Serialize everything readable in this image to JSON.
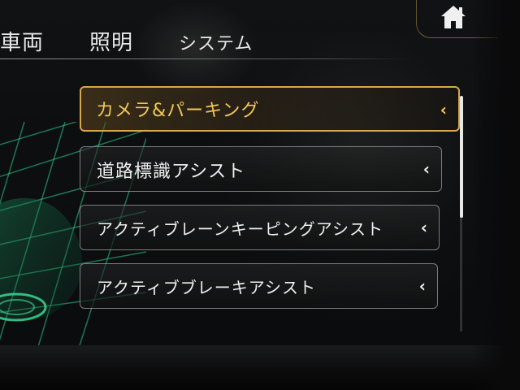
{
  "nav": {
    "tabs": [
      {
        "label": "車両",
        "active": false
      },
      {
        "label": "照明",
        "active": false
      },
      {
        "label": "システム",
        "active": true
      }
    ],
    "home_icon": "home-icon"
  },
  "menu": {
    "items": [
      {
        "label": "カメラ&パーキング",
        "selected": true,
        "chevron": "‹"
      },
      {
        "label": "道路標識アシスト",
        "selected": false,
        "chevron": "‹"
      },
      {
        "label": "アクティブレーンキーピングアシスト",
        "selected": false,
        "chevron": "‹"
      },
      {
        "label": "アクティブブレーキアシスト",
        "selected": false,
        "chevron": "‹"
      }
    ]
  },
  "colors": {
    "accent": "#d8a84a",
    "accent_text": "#f2c75a",
    "car_graphic": "#2fd08a",
    "text": "#f0f0f0"
  }
}
